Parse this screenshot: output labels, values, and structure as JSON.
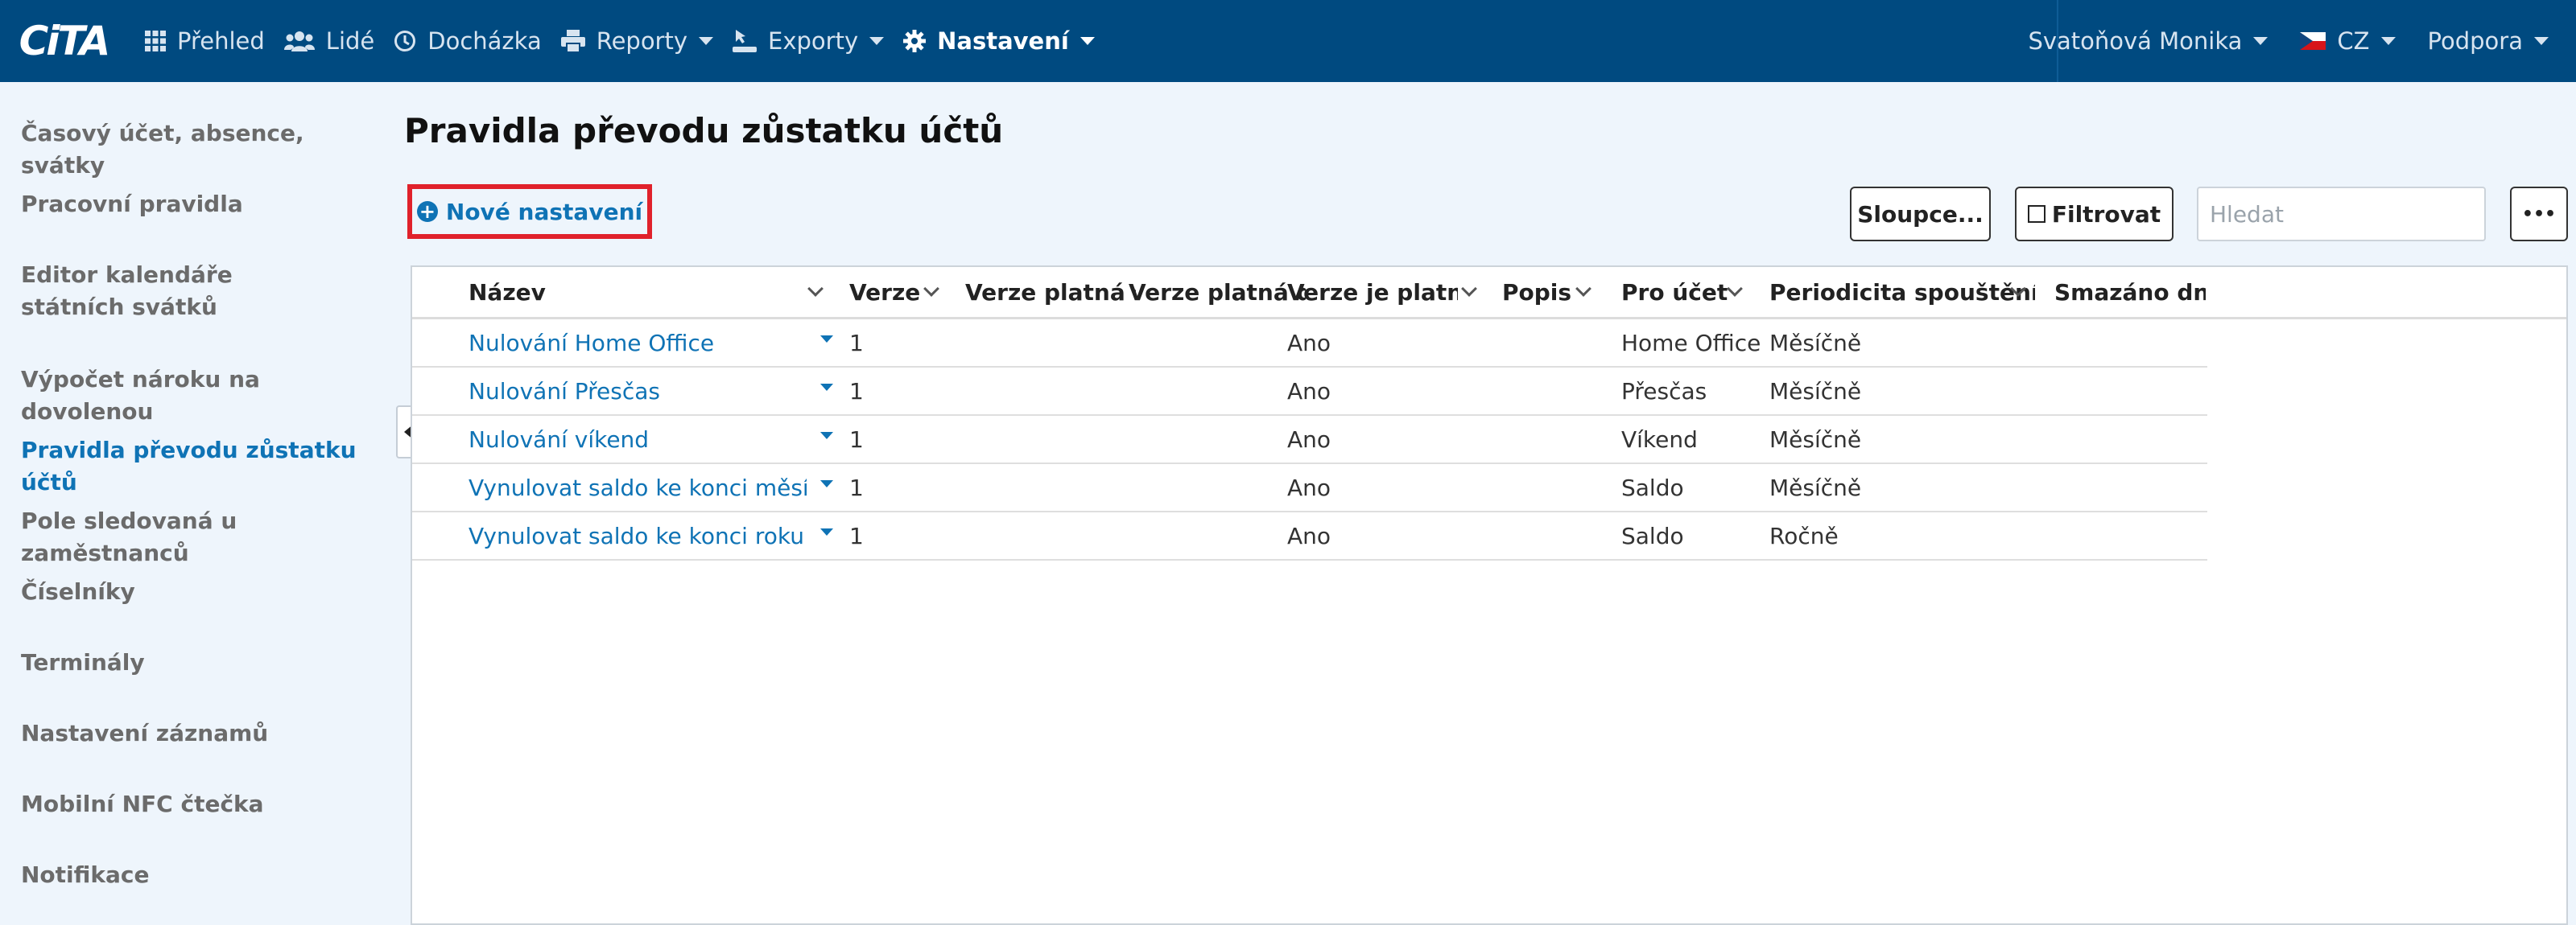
{
  "app": {
    "logo_text": "CiTA"
  },
  "nav": {
    "items": [
      {
        "label": "Přehled",
        "icon": "grid-icon"
      },
      {
        "label": "Lidé",
        "icon": "users-icon"
      },
      {
        "label": "Docházka",
        "icon": "clock-icon"
      },
      {
        "label": "Reporty",
        "icon": "printer-icon"
      },
      {
        "label": "Exporty",
        "icon": "export-icon"
      },
      {
        "label": "Nastavení",
        "icon": "gear-icon"
      }
    ],
    "user": "Svatoňová Monika",
    "language": "CZ",
    "support": "Podpora"
  },
  "sidebar": {
    "items": [
      {
        "label": "Časový účet, absence, svátky"
      },
      {
        "label": "Pracovní pravidla"
      },
      {
        "label": "Editor kalendáře státních svátků"
      },
      {
        "label": "Výpočet nároku na dovolenou"
      },
      {
        "label": "Pravidla převodu zůstatku účtů",
        "active": true
      },
      {
        "label": "Pole sledovaná u zaměstnanců"
      },
      {
        "label": "Číselníky"
      },
      {
        "label": "Terminály"
      },
      {
        "label": "Nastavení záznamů"
      },
      {
        "label": "Mobilní NFC čtečka"
      },
      {
        "label": "Notifikace"
      }
    ]
  },
  "page": {
    "title": "Pravidla převodu zůstatku účtů",
    "new_button": "Nové nastavení",
    "columns_button": "Sloupce...",
    "filter_button": "Filtrovat",
    "search_placeholder": "Hledat",
    "more_button": "•••"
  },
  "table": {
    "headers": [
      "Název",
      "Verze",
      "Verze platná od",
      "Verze platná do",
      "Verze je platná",
      "Popis",
      "Pro účet",
      "Periodicita spouštění",
      "Smazáno dne"
    ],
    "rows": [
      {
        "nazev": "Nulování Home Office",
        "verze": "1",
        "platna": "Ano",
        "ucet": "Home Office",
        "periodicita": "Měsíčně"
      },
      {
        "nazev": "Nulování Přesčas",
        "verze": "1",
        "platna": "Ano",
        "ucet": "Přesčas",
        "periodicita": "Měsíčně"
      },
      {
        "nazev": "Nulování víkend",
        "verze": "1",
        "platna": "Ano",
        "ucet": "Víkend",
        "periodicita": "Měsíčně"
      },
      {
        "nazev": "Vynulovat saldo ke konci měsí...",
        "verze": "1",
        "platna": "Ano",
        "ucet": "Saldo",
        "periodicita": "Měsíčně"
      },
      {
        "nazev": "Vynulovat saldo ke konci roku",
        "verze": "1",
        "platna": "Ano",
        "ucet": "Saldo",
        "periodicita": "Ročně"
      }
    ]
  },
  "colors": {
    "topbar": "#004a80",
    "accent": "#0f73b5",
    "highlight": "#e0212b"
  }
}
